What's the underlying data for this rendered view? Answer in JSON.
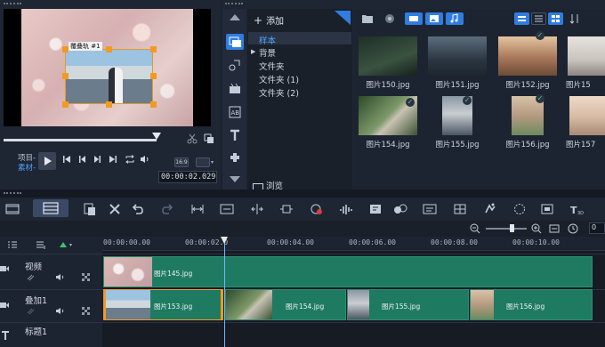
{
  "preview": {
    "overlay_tag": "覆叠轨 #1",
    "mode_project": "项目-",
    "mode_clip": "素材-",
    "timecode": "00:00:02.029",
    "ratio_label": "16:9"
  },
  "library": {
    "add_label": "添加",
    "folders": [
      "样本",
      "背景",
      "文件夹",
      "文件夹 (1)",
      "文件夹 (2)"
    ],
    "selected_folder": "样本",
    "browse_label": "浏览",
    "thumbnails": [
      {
        "label": "图片150.jpg",
        "checked": false,
        "color": "#2b3a30"
      },
      {
        "label": "图片151.jpg",
        "checked": false,
        "color": "#3e4a55"
      },
      {
        "label": "图片152.jpg",
        "checked": true,
        "color": "#a8775a"
      },
      {
        "label": "图片15",
        "checked": false,
        "color": "#c9c3bd"
      },
      {
        "label": "图片154.jpg",
        "checked": true,
        "color": "#6e8a5e"
      },
      {
        "label": "图片155.jpg",
        "checked": true,
        "color": "#6f7c8a"
      },
      {
        "label": "图片156.jpg",
        "checked": true,
        "color": "#b59a80"
      },
      {
        "label": "图片157",
        "checked": false,
        "color": "#d6b9a3"
      }
    ]
  },
  "timeline": {
    "ruler_ticks": [
      "00:00:00.00",
      "00:00:02.0",
      "00:00:04.00",
      "00:00:06.00",
      "00:00:08.00",
      "00:00:10.00"
    ],
    "right_timecode": "0",
    "tracks": [
      {
        "name": "视频"
      },
      {
        "name": "叠加1"
      },
      {
        "name": "标题1"
      }
    ],
    "video_clip": "图片145.jpg",
    "overlay_clips": [
      "图片153.jpg",
      "图片154.jpg",
      "图片155.jpg",
      "图片156.jpg"
    ]
  },
  "colors": {
    "clip_green": "#1f7a62",
    "accent_blue": "#2f7de1",
    "handle_orange": "#f19a24"
  }
}
